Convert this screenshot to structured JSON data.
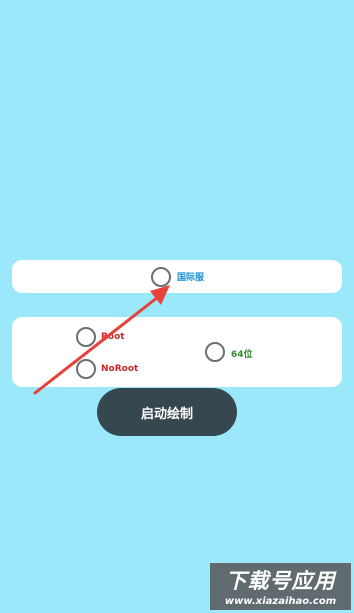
{
  "server_option": {
    "label": "国际服",
    "color": "#1a8fd6",
    "selected": false
  },
  "mode_options": [
    {
      "label": "Root",
      "color": "#c62828",
      "selected": false
    },
    {
      "label": "NoRoot",
      "color": "#c62828",
      "selected": false
    }
  ],
  "arch_option": {
    "label": "64位",
    "color": "#2e8b2e",
    "selected": false
  },
  "start_button": {
    "label": "启动绘制"
  },
  "watermark": {
    "title": "下载号应用",
    "url": "www.xiazaihao.com"
  },
  "colors": {
    "background": "#9be8fb",
    "card": "#ffffff",
    "button": "#37474f",
    "annotation_arrow": "#e8413c"
  }
}
